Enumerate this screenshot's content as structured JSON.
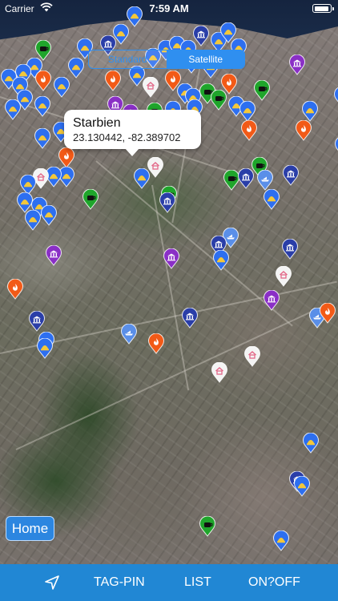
{
  "status_bar": {
    "carrier": "Carrier",
    "time": "7:59 AM"
  },
  "map_type_control": {
    "options": [
      "Standard",
      "Satellite"
    ],
    "selected": "Satellite"
  },
  "callout": {
    "title": "Starbien",
    "coordinates": "23.130442, -82.389702"
  },
  "home_button": {
    "label": "Home"
  },
  "toolbar": {
    "location_icon": "location-arrow-icon",
    "tag_pin": "TAG-PIN",
    "list": "LIST",
    "on_off": "ON?OFF"
  },
  "colors": {
    "pin_blue": "#2d6ff0",
    "pin_navy": "#2a3ea8",
    "pin_green": "#1fa52b",
    "pin_purple": "#8a2fc6",
    "pin_orange": "#f25a17",
    "pin_white": "#f4f4f4",
    "pin_light_blue": "#5a8fe8",
    "toolbar": "#2187d4"
  },
  "pin_types": {
    "b": "dome-icon",
    "n": "museum-icon",
    "g": "cup-icon",
    "p": "museum-icon",
    "o": "flame-icon",
    "w": "house-icon",
    "l": "boat-icon"
  }
}
